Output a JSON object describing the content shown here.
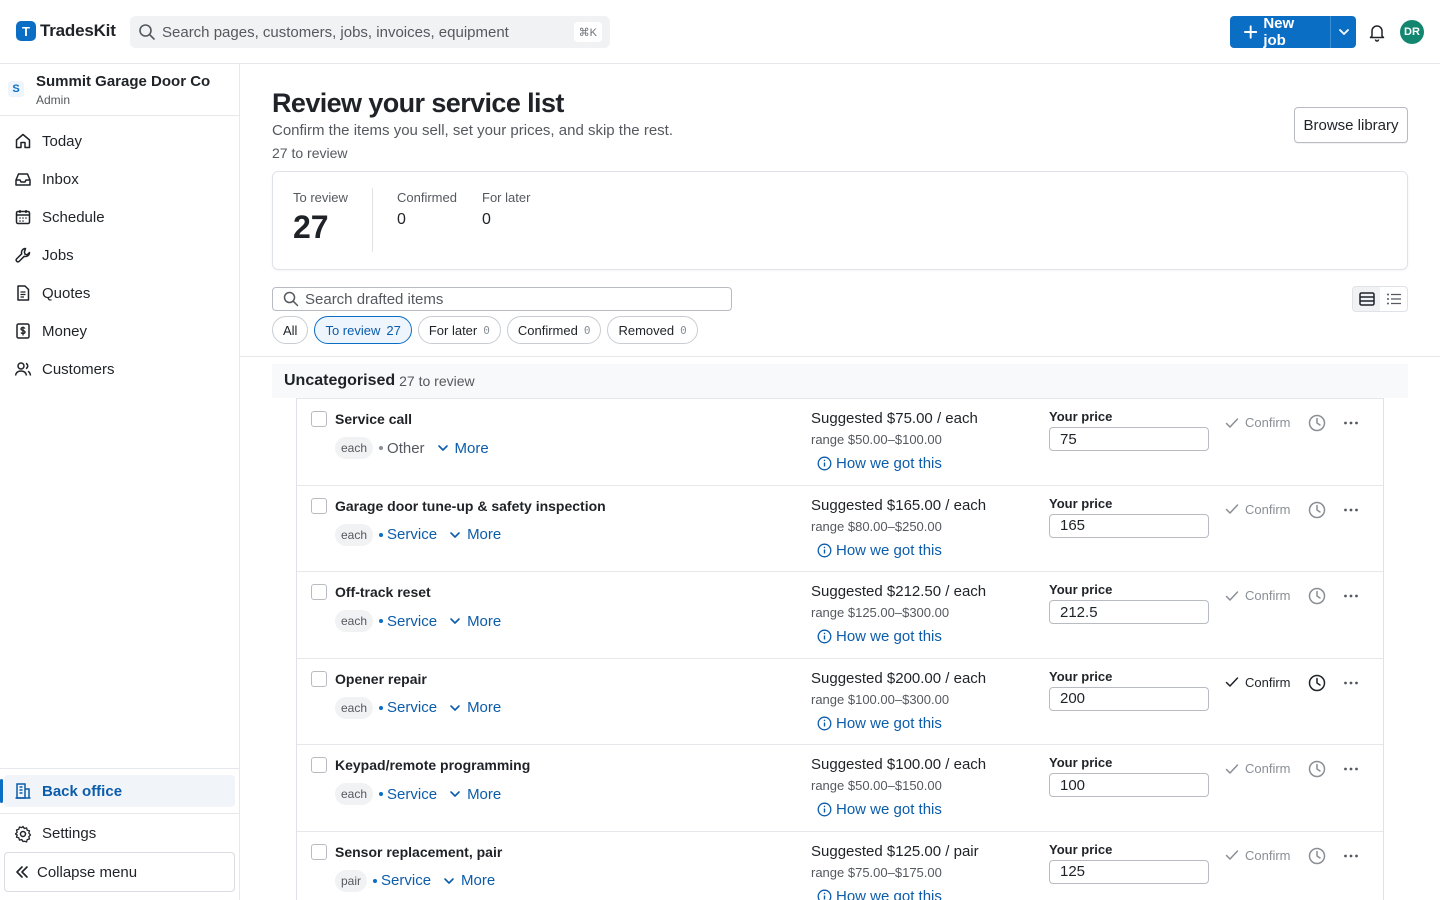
{
  "app": {
    "logo_letter": "T",
    "name": "TradesKit"
  },
  "header": {
    "search_placeholder": "Search pages, customers, jobs, invoices, equipment",
    "search_shortcut": "⌘K",
    "new_job_label": "New job",
    "avatar_initials": "DR"
  },
  "sidebar": {
    "org_initial": "S",
    "org_name": "Summit Garage Door Co",
    "org_role": "Admin",
    "items": [
      {
        "label": "Today",
        "icon": "home-icon"
      },
      {
        "label": "Inbox",
        "icon": "inbox-icon"
      },
      {
        "label": "Schedule",
        "icon": "calendar-icon"
      },
      {
        "label": "Jobs",
        "icon": "wrench-icon"
      },
      {
        "label": "Quotes",
        "icon": "document-icon"
      },
      {
        "label": "Money",
        "icon": "dollar-icon"
      },
      {
        "label": "Customers",
        "icon": "people-icon"
      }
    ],
    "back_office_label": "Back office",
    "settings_label": "Settings",
    "collapse_label": "Collapse menu"
  },
  "page": {
    "title": "Review your service list",
    "subtitle": "Confirm the items you sell, set your prices, and skip the rest.",
    "count_text": "27 to review",
    "browse_label": "Browse library"
  },
  "stats": {
    "to_review_label": "To review",
    "to_review_value": "27",
    "confirmed_label": "Confirmed",
    "confirmed_value": "0",
    "later_label": "For later",
    "later_value": "0"
  },
  "search": {
    "placeholder": "Search drafted items"
  },
  "filters": [
    {
      "label": "All",
      "count": ""
    },
    {
      "label": "To review",
      "count": "27"
    },
    {
      "label": "For later",
      "count": "0"
    },
    {
      "label": "Confirmed",
      "count": "0"
    },
    {
      "label": "Removed",
      "count": "0"
    }
  ],
  "group": {
    "name": "Uncategorised",
    "count": "27 to review"
  },
  "labels": {
    "more": "More",
    "how": "How we got this",
    "your_price": "Your price",
    "confirm": "Confirm"
  },
  "items": [
    {
      "name": "Service call",
      "unit": "each",
      "category": "Other",
      "suggested": "Suggested $75.00 / each",
      "range": "range $50.00–$100.00",
      "price": "75"
    },
    {
      "name": "Garage door tune-up & safety inspection",
      "unit": "each",
      "category": "Service",
      "suggested": "Suggested $165.00 / each",
      "range": "range $80.00–$250.00",
      "price": "165"
    },
    {
      "name": "Off-track reset",
      "unit": "each",
      "category": "Service",
      "suggested": "Suggested $212.50 / each",
      "range": "range $125.00–$300.00",
      "price": "212.5"
    },
    {
      "name": "Opener repair",
      "unit": "each",
      "category": "Service",
      "suggested": "Suggested $200.00 / each",
      "range": "range $100.00–$300.00",
      "price": "200"
    },
    {
      "name": "Keypad/remote programming",
      "unit": "each",
      "category": "Service",
      "suggested": "Suggested $100.00 / each",
      "range": "range $50.00–$150.00",
      "price": "100"
    },
    {
      "name": "Sensor replacement, pair",
      "unit": "pair",
      "category": "Service",
      "suggested": "Suggested $125.00 / pair",
      "range": "range $75.00–$175.00",
      "price": "125"
    }
  ],
  "colors": {
    "brand": "#0b6ec5",
    "link": "#0b5cab",
    "avatar": "#13866f"
  }
}
